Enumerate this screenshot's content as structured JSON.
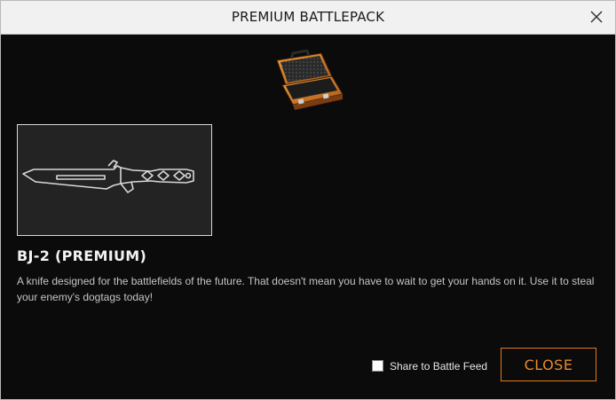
{
  "dialog": {
    "title": "PREMIUM BATTLEPACK",
    "close_icon": "close-x-icon"
  },
  "battlepack": {
    "icon": "briefcase-icon"
  },
  "item": {
    "image_icon": "knife-icon",
    "name": "BJ-2 (PREMIUM)",
    "description": "A knife designed for the battlefields of the future. That doesn't mean you have to wait to get your hands on it. Use it to steal your enemy's dogtags today!"
  },
  "footer": {
    "share_label": "Share to Battle Feed",
    "share_checked": false,
    "close_label": "CLOSE"
  },
  "colors": {
    "accent": "#e88a2a",
    "background": "#0b0b0b",
    "titlebar": "#f1f1f1"
  }
}
